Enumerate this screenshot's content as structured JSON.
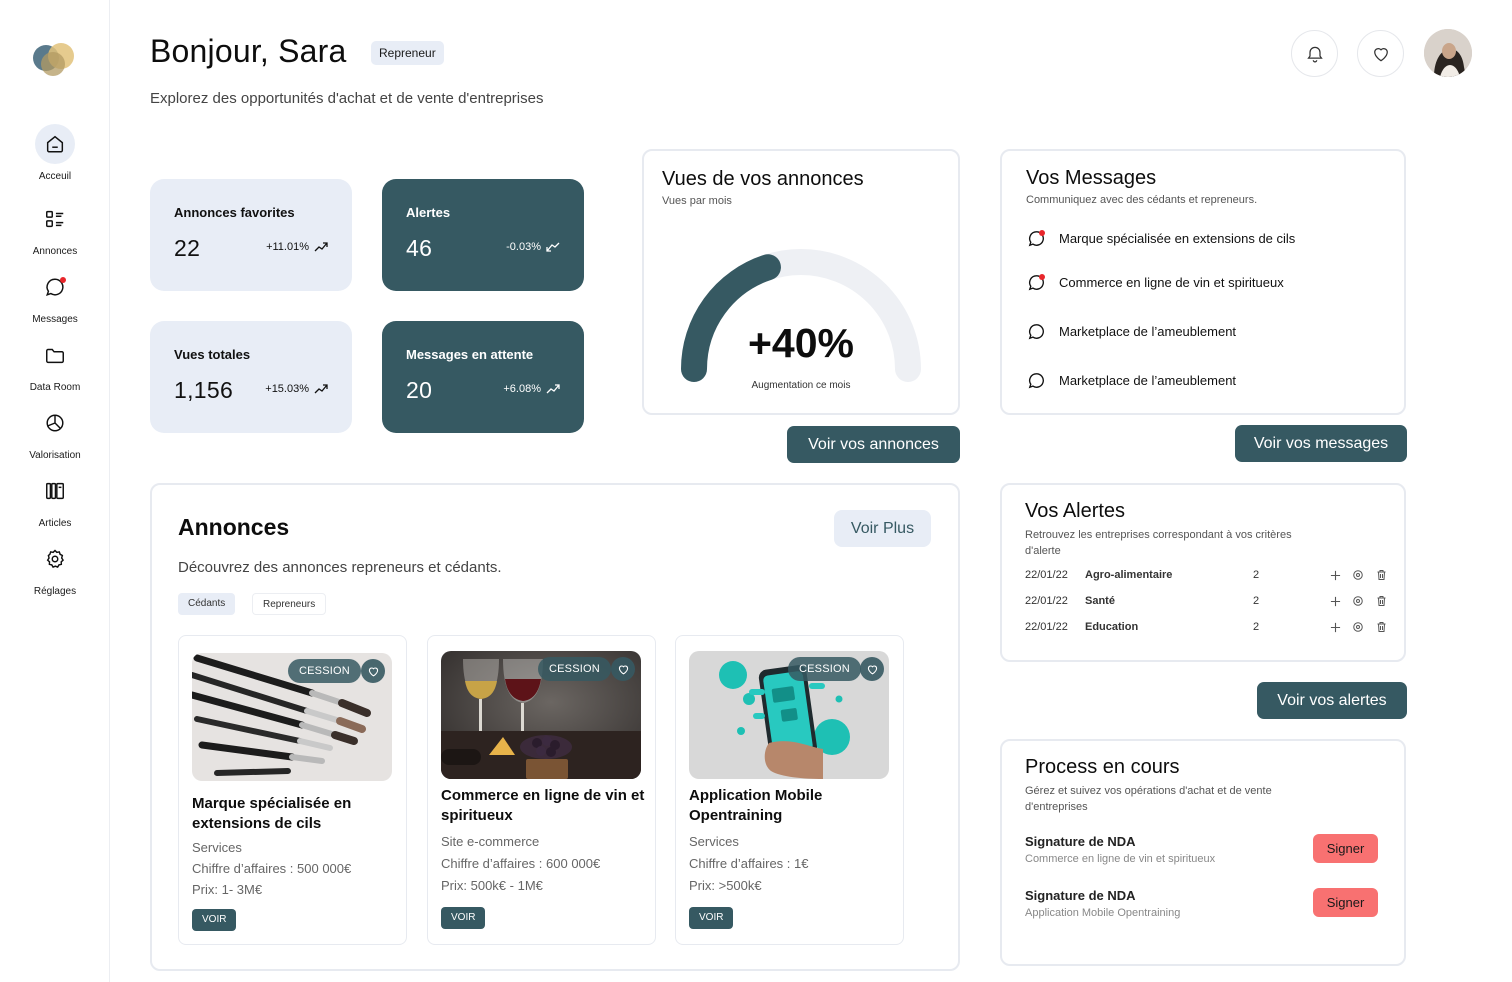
{
  "sidebar": {
    "items": [
      {
        "label": "Acceuil",
        "icon": "home-icon"
      },
      {
        "label": "Annonces",
        "icon": "list-icon"
      },
      {
        "label": "Messages",
        "icon": "message-icon"
      },
      {
        "label": "Data Room",
        "icon": "folder-icon"
      },
      {
        "label": "Valorisation",
        "icon": "pie-chart-icon"
      },
      {
        "label": "Articles",
        "icon": "articles-icon"
      },
      {
        "label": "Réglages",
        "icon": "gear-icon"
      }
    ]
  },
  "header": {
    "greeting": "Bonjour, Sara",
    "role": "Repreneur",
    "subtitle": "Explorez des opportunités d'achat et de vente d'entreprises"
  },
  "stats": [
    {
      "title": "Annonces favorites",
      "value": "22",
      "delta": "+11.01%",
      "trend": "up"
    },
    {
      "title": "Alertes",
      "value": "46",
      "delta": "-0.03%",
      "trend": "down"
    },
    {
      "title": "Vues totales",
      "value": "1,156",
      "delta": "+15.03%",
      "trend": "up"
    },
    {
      "title": "Messages en attente",
      "value": "20",
      "delta": "+6.08%",
      "trend": "up"
    }
  ],
  "views": {
    "title": "Vues de vos annonces",
    "subtitle": "Vues par mois",
    "value": "+40%",
    "fraction": 0.4,
    "caption": "Augmentation ce mois",
    "button": "Voir vos annonces",
    "accent": "#365962",
    "track": "#eef0f4"
  },
  "messages": {
    "title": "Vos Messages",
    "subtitle": "Communiquez avec des cédants et repreneurs.",
    "items": [
      {
        "label": "Marque spécialisée en extensions de cils",
        "unread": true
      },
      {
        "label": "Commerce en ligne de vin et spiritueux",
        "unread": true
      },
      {
        "label": "Marketplace de l’ameublement",
        "unread": false
      },
      {
        "label": "Marketplace de l’ameublement",
        "unread": false
      }
    ],
    "button": "Voir vos messages"
  },
  "annonces": {
    "title": "Annonces",
    "subtitle": "Découvrez des annonces repreneurs et cédants.",
    "more": "Voir Plus",
    "filters": [
      "Cédants",
      "Repreneurs"
    ],
    "cards": [
      {
        "tag": "CESSION",
        "title": "Marque spécialisée en extensions de cils",
        "category": "Services",
        "revenue": "Chiffre d’affaires : 500 000€",
        "price": "Prix: 1- 3M€",
        "button": "VOIR"
      },
      {
        "tag": "CESSION",
        "title": "Commerce en ligne de vin et spiritueux",
        "category": "Site e-commerce",
        "revenue": "Chiffre d’affaires : 600 000€",
        "price": "Prix: 500k€ - 1M€",
        "button": "VOIR"
      },
      {
        "tag": "CESSION",
        "title": "Application Mobile Opentraining",
        "category": "Services",
        "revenue": "Chiffre d’affaires : 1€",
        "price": "Prix: >500k€",
        "button": "VOIR"
      }
    ]
  },
  "alertes": {
    "title": "Vos Alertes",
    "subtitle": "Retrouvez les entreprises correspondant à vos critères d'alerte",
    "rows": [
      {
        "date": "22/01/22",
        "name": "Agro-alimentaire",
        "count": "2"
      },
      {
        "date": "22/01/22",
        "name": "Santé",
        "count": "2"
      },
      {
        "date": "22/01/22",
        "name": "Education",
        "count": "2"
      }
    ],
    "button": "Voir vos alertes"
  },
  "process": {
    "title": "Process en cours",
    "subtitle": "Gérez et suivez vos opérations d'achat et de vente d'entreprises",
    "items": [
      {
        "title": "Signature de NDA",
        "detail": "Commerce en ligne de vin et spiritueux",
        "button": "Signer"
      },
      {
        "title": "Signature de NDA",
        "detail": "Application Mobile Opentraining",
        "button": "Signer"
      }
    ]
  }
}
